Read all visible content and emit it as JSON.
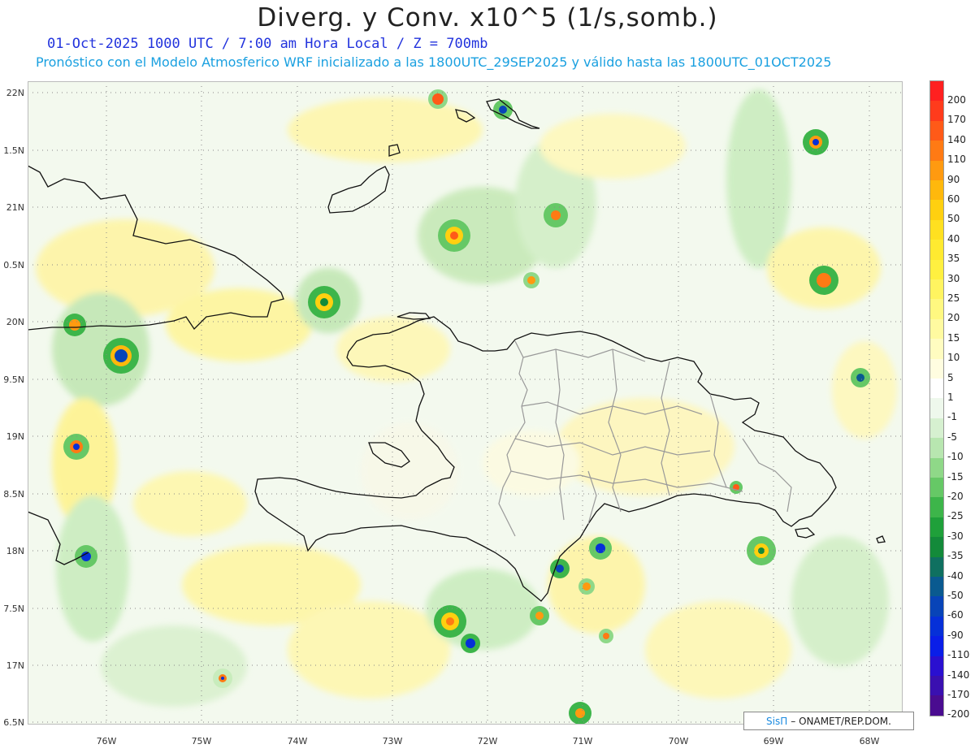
{
  "header": {
    "title": "Diverg. y Conv. x10^5 (1/s,somb.)",
    "subtitle_1": "01-Oct-2025  1000 UTC / 7:00 am Hora Local / Z = 700mb",
    "subtitle_2": "Pronóstico con el Modelo Atmosferico WRF inicializado a las 1800UTC_29SEP2025 y válido hasta las  1800UTC_01OCT2025"
  },
  "axes": {
    "lat_labels": [
      "22N",
      "1.5N",
      "21N",
      "0.5N",
      "20N",
      "9.5N",
      "19N",
      "8.5N",
      "18N",
      "7.5N",
      "17N",
      "6.5N"
    ],
    "lon_labels": [
      "76W",
      "75W",
      "74W",
      "73W",
      "72W",
      "71W",
      "70W",
      "69W",
      "68W"
    ]
  },
  "colorbar": {
    "levels": [
      "200",
      "170",
      "140",
      "110",
      "90",
      "60",
      "50",
      "40",
      "35",
      "30",
      "25",
      "20",
      "15",
      "10",
      "5",
      "1",
      "-1",
      "-5",
      "-10",
      "-15",
      "-20",
      "-25",
      "-30",
      "-35",
      "-40",
      "-50",
      "-60",
      "-90",
      "-110",
      "-140",
      "-170",
      "-200"
    ],
    "colors": [
      "#ff2020",
      "#ff3b1c",
      "#ff5a18",
      "#ff7a14",
      "#ff9a10",
      "#ffb80c",
      "#ffd010",
      "#ffe020",
      "#ffea30",
      "#fff040",
      "#fff460",
      "#fff880",
      "#fffaa0",
      "#fffcc0",
      "#fffde0",
      "#ffffff",
      "#eef8ec",
      "#d6f0d0",
      "#b8e6b0",
      "#8fd888",
      "#66c866",
      "#3db54a",
      "#1fa03a",
      "#138a3a",
      "#0f7060",
      "#0a5a90",
      "#0844b8",
      "#0630d8",
      "#0a1ee8",
      "#2a10d0",
      "#3a10b0",
      "#4a0c90"
    ]
  },
  "credit": {
    "logo_text": "SisΠ",
    "text": "– ONAMET/REP.DOM."
  }
}
